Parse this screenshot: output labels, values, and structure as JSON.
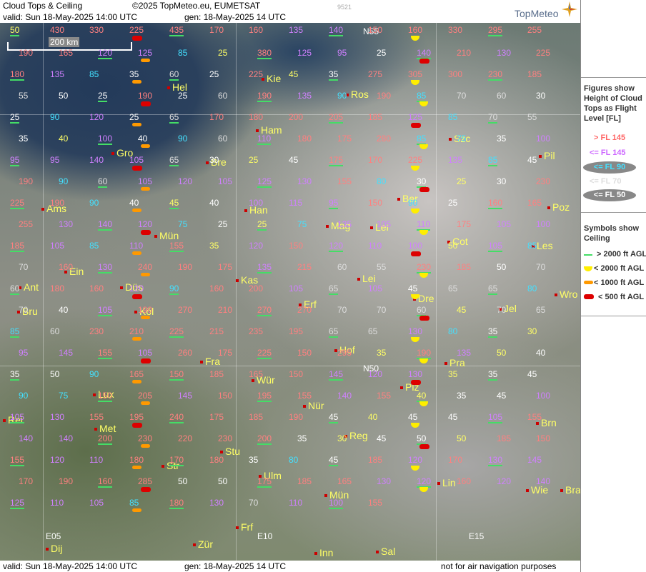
{
  "header": {
    "title": "Cloud Tops & Ceiling",
    "copyright": "©2025 TopMeteo.eu, EUMETSAT",
    "valid": "valid:  Sun  18-May-2025  14:00 UTC",
    "gen": "gen: 18-May-2025 14 UTC",
    "image_id": "9521",
    "logo": "TopMeteo",
    "logo_icon": "compass-star-icon"
  },
  "footer": {
    "valid": "valid:  Sun  18-May-2025  14:00 UTC",
    "gen": "gen: 18-May-2025 14 UTC",
    "disclaimer": "not for air navigation purposes"
  },
  "scale": {
    "label": "200 km"
  },
  "legend": {
    "tops_title": "Figures show Height of Cloud Tops as Flight Level  [FL]",
    "tops_items": [
      {
        "label": "> FL 145",
        "color": "#ff6666"
      },
      {
        "label": "<= FL 145",
        "color": "#cc66ff"
      },
      {
        "label": "<= FL 90",
        "color": "#44e0ff"
      },
      {
        "label": "<= FL 70",
        "color": "#dddddd"
      },
      {
        "label": "<= FL 50",
        "color": "#ffffff"
      }
    ],
    "ceiling_title": "Symbols show Ceiling",
    "ceiling_items": [
      {
        "label": "> 2000 ft AGL",
        "symbol": "green-line"
      },
      {
        "label": "< 2000 ft AGL",
        "symbol": "yellow-half-circle"
      },
      {
        "label": "< 1000 ft AGL",
        "symbol": "orange-bar"
      },
      {
        "label": "< 500 ft AGL",
        "symbol": "red-bar"
      }
    ]
  },
  "cities": [
    {
      "name": "Hel"
    },
    {
      "name": "Kie"
    },
    {
      "name": "Ros"
    },
    {
      "name": "Ham"
    },
    {
      "name": "Gro"
    },
    {
      "name": "Bre"
    },
    {
      "name": "Szc"
    },
    {
      "name": "Pil"
    },
    {
      "name": "Ams"
    },
    {
      "name": "Ber"
    },
    {
      "name": "Han"
    },
    {
      "name": "Poz"
    },
    {
      "name": "Mag"
    },
    {
      "name": "Lei"
    },
    {
      "name": "Cot"
    },
    {
      "name": "Mün"
    },
    {
      "name": "Ein"
    },
    {
      "name": "Les"
    },
    {
      "name": "Ant"
    },
    {
      "name": "Düs"
    },
    {
      "name": "Kas"
    },
    {
      "name": "Lei"
    },
    {
      "name": "Dre"
    },
    {
      "name": "Wro"
    },
    {
      "name": "Bru"
    },
    {
      "name": "Köl"
    },
    {
      "name": "Erf"
    },
    {
      "name": "Jel"
    },
    {
      "name": "Hof"
    },
    {
      "name": "Fra"
    },
    {
      "name": "Pra"
    },
    {
      "name": "Lux"
    },
    {
      "name": "Wür"
    },
    {
      "name": "Plz"
    },
    {
      "name": "Rei"
    },
    {
      "name": "Nür"
    },
    {
      "name": "Met"
    },
    {
      "name": "Reg"
    },
    {
      "name": "Brn"
    },
    {
      "name": "Str"
    },
    {
      "name": "Stu"
    },
    {
      "name": "Ulm"
    },
    {
      "name": "Lin"
    },
    {
      "name": "Mün"
    },
    {
      "name": "Wie"
    },
    {
      "name": "Bra"
    },
    {
      "name": "Frf"
    },
    {
      "name": "Zür"
    },
    {
      "name": "Inn"
    },
    {
      "name": "Sal"
    },
    {
      "name": "Dij"
    }
  ],
  "grid_labels": [
    "N55",
    "N50",
    "E05",
    "E10",
    "E15"
  ],
  "values": [
    "50",
    "430",
    "330",
    "225",
    "435",
    "170",
    "160",
    "135",
    "140",
    "150",
    "160",
    "330",
    "295",
    "255",
    "190",
    "165",
    "120",
    "125",
    "85",
    "25",
    "380",
    "125",
    "95",
    "25",
    "140",
    "210",
    "130",
    "225",
    "180",
    "135",
    "85",
    "35",
    "60",
    "25",
    "225",
    "45",
    "35",
    "275",
    "305",
    "300",
    "230",
    "185",
    "55",
    "50",
    "25",
    "190",
    "25",
    "60",
    "190",
    "135",
    "90",
    "190",
    "85",
    "70",
    "60",
    "30",
    "25",
    "90",
    "120",
    "25",
    "65",
    "170",
    "180",
    "200",
    "205",
    "185",
    "125",
    "85",
    "70",
    "55",
    "35",
    "40",
    "100",
    "40",
    "90",
    "60",
    "110",
    "180",
    "175",
    "280",
    "85",
    "75",
    "35",
    "100",
    "95",
    "95",
    "140",
    "105",
    "65",
    "30",
    "25",
    "45",
    "175",
    "170",
    "225",
    "135",
    "85",
    "45",
    "190",
    "90",
    "60",
    "105",
    "120",
    "105",
    "125",
    "130",
    "155",
    "80",
    "30",
    "25",
    "30",
    "230",
    "225",
    "190",
    "90",
    "40",
    "45",
    "40",
    "100",
    "115",
    "95",
    "150",
    "90",
    "25",
    "160",
    "165",
    "255",
    "130",
    "140",
    "120",
    "75",
    "25",
    "25",
    "75",
    "135",
    "105",
    "110",
    "175",
    "105",
    "100",
    "185",
    "105",
    "85",
    "110",
    "155",
    "35",
    "120",
    "150",
    "120",
    "110",
    "100",
    "50",
    "105",
    "85",
    "70",
    "160",
    "130",
    "240",
    "190",
    "175",
    "135",
    "215",
    "60",
    "55",
    "230",
    "185",
    "50",
    "70",
    "60",
    "180",
    "160",
    "120",
    "90",
    "160",
    "200",
    "105",
    "65",
    "105",
    "45",
    "65",
    "65",
    "80",
    "70",
    "40",
    "105",
    "190",
    "270",
    "210",
    "270",
    "270",
    "70",
    "70",
    "60",
    "45",
    "70",
    "65",
    "85",
    "60",
    "230",
    "210",
    "225",
    "215",
    "235",
    "195",
    "65",
    "65",
    "130",
    "80",
    "35",
    "30",
    "95",
    "145",
    "155",
    "105",
    "260",
    "175",
    "225",
    "150",
    "295",
    "35",
    "190",
    "135",
    "50",
    "40",
    "35",
    "50",
    "90",
    "165",
    "150",
    "185",
    "165",
    "150",
    "145",
    "120",
    "130",
    "35",
    "35",
    "45",
    "90",
    "75",
    "150",
    "205",
    "145",
    "150",
    "195",
    "155",
    "140",
    "155",
    "40",
    "35",
    "45",
    "100",
    "105",
    "130",
    "155",
    "195",
    "240",
    "175",
    "185",
    "190",
    "45",
    "40",
    "45",
    "45",
    "105",
    "155",
    "140",
    "140",
    "200",
    "230",
    "220",
    "230",
    "200",
    "35",
    "30",
    "45",
    "50",
    "50",
    "185",
    "150",
    "155",
    "120",
    "110",
    "180",
    "170",
    "180",
    "35",
    "80",
    "45",
    "185",
    "120",
    "170",
    "130",
    "145",
    "170",
    "190",
    "160",
    "285",
    "50",
    "50",
    "175",
    "185",
    "165",
    "130",
    "120",
    "160",
    "120",
    "140",
    "125",
    "110",
    "105",
    "85",
    "180",
    "130",
    "70",
    "110",
    "100",
    "155"
  ]
}
